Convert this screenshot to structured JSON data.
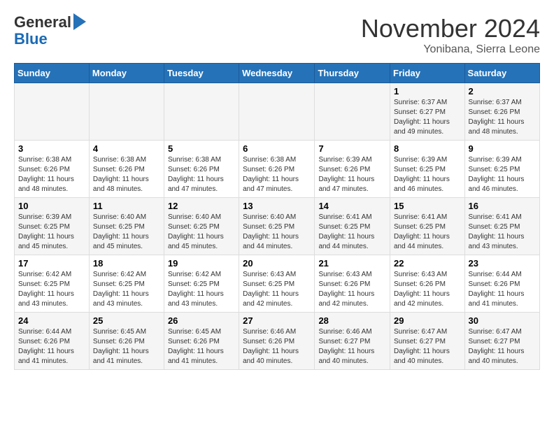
{
  "header": {
    "logo_general": "General",
    "logo_blue": "Blue",
    "month_title": "November 2024",
    "location": "Yonibana, Sierra Leone"
  },
  "days_of_week": [
    "Sunday",
    "Monday",
    "Tuesday",
    "Wednesday",
    "Thursday",
    "Friday",
    "Saturday"
  ],
  "weeks": [
    [
      {
        "day": "",
        "info": ""
      },
      {
        "day": "",
        "info": ""
      },
      {
        "day": "",
        "info": ""
      },
      {
        "day": "",
        "info": ""
      },
      {
        "day": "",
        "info": ""
      },
      {
        "day": "1",
        "info": "Sunrise: 6:37 AM\nSunset: 6:27 PM\nDaylight: 11 hours and 49 minutes."
      },
      {
        "day": "2",
        "info": "Sunrise: 6:37 AM\nSunset: 6:26 PM\nDaylight: 11 hours and 48 minutes."
      }
    ],
    [
      {
        "day": "3",
        "info": "Sunrise: 6:38 AM\nSunset: 6:26 PM\nDaylight: 11 hours and 48 minutes."
      },
      {
        "day": "4",
        "info": "Sunrise: 6:38 AM\nSunset: 6:26 PM\nDaylight: 11 hours and 48 minutes."
      },
      {
        "day": "5",
        "info": "Sunrise: 6:38 AM\nSunset: 6:26 PM\nDaylight: 11 hours and 47 minutes."
      },
      {
        "day": "6",
        "info": "Sunrise: 6:38 AM\nSunset: 6:26 PM\nDaylight: 11 hours and 47 minutes."
      },
      {
        "day": "7",
        "info": "Sunrise: 6:39 AM\nSunset: 6:26 PM\nDaylight: 11 hours and 47 minutes."
      },
      {
        "day": "8",
        "info": "Sunrise: 6:39 AM\nSunset: 6:25 PM\nDaylight: 11 hours and 46 minutes."
      },
      {
        "day": "9",
        "info": "Sunrise: 6:39 AM\nSunset: 6:25 PM\nDaylight: 11 hours and 46 minutes."
      }
    ],
    [
      {
        "day": "10",
        "info": "Sunrise: 6:39 AM\nSunset: 6:25 PM\nDaylight: 11 hours and 45 minutes."
      },
      {
        "day": "11",
        "info": "Sunrise: 6:40 AM\nSunset: 6:25 PM\nDaylight: 11 hours and 45 minutes."
      },
      {
        "day": "12",
        "info": "Sunrise: 6:40 AM\nSunset: 6:25 PM\nDaylight: 11 hours and 45 minutes."
      },
      {
        "day": "13",
        "info": "Sunrise: 6:40 AM\nSunset: 6:25 PM\nDaylight: 11 hours and 44 minutes."
      },
      {
        "day": "14",
        "info": "Sunrise: 6:41 AM\nSunset: 6:25 PM\nDaylight: 11 hours and 44 minutes."
      },
      {
        "day": "15",
        "info": "Sunrise: 6:41 AM\nSunset: 6:25 PM\nDaylight: 11 hours and 44 minutes."
      },
      {
        "day": "16",
        "info": "Sunrise: 6:41 AM\nSunset: 6:25 PM\nDaylight: 11 hours and 43 minutes."
      }
    ],
    [
      {
        "day": "17",
        "info": "Sunrise: 6:42 AM\nSunset: 6:25 PM\nDaylight: 11 hours and 43 minutes."
      },
      {
        "day": "18",
        "info": "Sunrise: 6:42 AM\nSunset: 6:25 PM\nDaylight: 11 hours and 43 minutes."
      },
      {
        "day": "19",
        "info": "Sunrise: 6:42 AM\nSunset: 6:25 PM\nDaylight: 11 hours and 43 minutes."
      },
      {
        "day": "20",
        "info": "Sunrise: 6:43 AM\nSunset: 6:25 PM\nDaylight: 11 hours and 42 minutes."
      },
      {
        "day": "21",
        "info": "Sunrise: 6:43 AM\nSunset: 6:26 PM\nDaylight: 11 hours and 42 minutes."
      },
      {
        "day": "22",
        "info": "Sunrise: 6:43 AM\nSunset: 6:26 PM\nDaylight: 11 hours and 42 minutes."
      },
      {
        "day": "23",
        "info": "Sunrise: 6:44 AM\nSunset: 6:26 PM\nDaylight: 11 hours and 41 minutes."
      }
    ],
    [
      {
        "day": "24",
        "info": "Sunrise: 6:44 AM\nSunset: 6:26 PM\nDaylight: 11 hours and 41 minutes."
      },
      {
        "day": "25",
        "info": "Sunrise: 6:45 AM\nSunset: 6:26 PM\nDaylight: 11 hours and 41 minutes."
      },
      {
        "day": "26",
        "info": "Sunrise: 6:45 AM\nSunset: 6:26 PM\nDaylight: 11 hours and 41 minutes."
      },
      {
        "day": "27",
        "info": "Sunrise: 6:46 AM\nSunset: 6:26 PM\nDaylight: 11 hours and 40 minutes."
      },
      {
        "day": "28",
        "info": "Sunrise: 6:46 AM\nSunset: 6:27 PM\nDaylight: 11 hours and 40 minutes."
      },
      {
        "day": "29",
        "info": "Sunrise: 6:47 AM\nSunset: 6:27 PM\nDaylight: 11 hours and 40 minutes."
      },
      {
        "day": "30",
        "info": "Sunrise: 6:47 AM\nSunset: 6:27 PM\nDaylight: 11 hours and 40 minutes."
      }
    ]
  ]
}
